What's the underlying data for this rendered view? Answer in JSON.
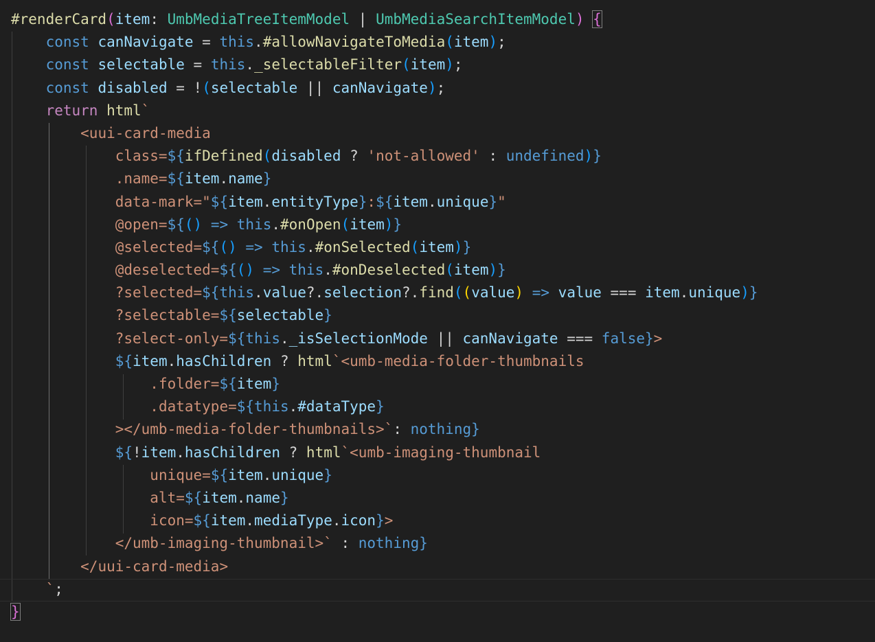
{
  "editor": {
    "language": "typescript",
    "theme_colors": {
      "background": "#1f1f1f",
      "keyword": "#569cd6",
      "function": "#dcdcaa",
      "variable": "#9cdcfe",
      "type": "#4ec9b0",
      "string": "#ce9178",
      "bracket_gold": "#ffd700",
      "bracket_orchid": "#da70d6",
      "bracket_blue": "#179fff"
    },
    "lines": [
      [
        [
          "fn",
          "#renderCard"
        ],
        [
          "b2",
          "("
        ],
        [
          "var",
          "item"
        ],
        [
          "op",
          ": "
        ],
        [
          "type",
          "UmbMediaTreeItemModel"
        ],
        [
          "op",
          " | "
        ],
        [
          "type",
          "UmbMediaSearchItemModel"
        ],
        [
          "b2",
          ")"
        ],
        [
          "op",
          " "
        ],
        [
          "b2hl",
          "{"
        ]
      ],
      [
        [
          "op",
          "    "
        ],
        [
          "kw",
          "const"
        ],
        [
          "op",
          " "
        ],
        [
          "var",
          "canNavigate"
        ],
        [
          "op",
          " = "
        ],
        [
          "kw",
          "this"
        ],
        [
          "op",
          "."
        ],
        [
          "fn",
          "#allowNavigateToMedia"
        ],
        [
          "b3",
          "("
        ],
        [
          "var",
          "item"
        ],
        [
          "b3",
          ")"
        ],
        [
          "op",
          ";"
        ]
      ],
      [
        [
          "op",
          "    "
        ],
        [
          "kw",
          "const"
        ],
        [
          "op",
          " "
        ],
        [
          "var",
          "selectable"
        ],
        [
          "op",
          " = "
        ],
        [
          "kw",
          "this"
        ],
        [
          "op",
          "."
        ],
        [
          "fn",
          "_selectableFilter"
        ],
        [
          "b3",
          "("
        ],
        [
          "var",
          "item"
        ],
        [
          "b3",
          ")"
        ],
        [
          "op",
          ";"
        ]
      ],
      [
        [
          "op",
          "    "
        ],
        [
          "kw",
          "const"
        ],
        [
          "op",
          " "
        ],
        [
          "var",
          "disabled"
        ],
        [
          "op",
          " = !"
        ],
        [
          "b3",
          "("
        ],
        [
          "var",
          "selectable"
        ],
        [
          "op",
          " || "
        ],
        [
          "var",
          "canNavigate"
        ],
        [
          "b3",
          ")"
        ],
        [
          "op",
          ";"
        ]
      ],
      [
        [
          "op",
          "    "
        ],
        [
          "ctl",
          "return"
        ],
        [
          "op",
          " "
        ],
        [
          "fn",
          "html"
        ],
        [
          "str",
          "`"
        ]
      ],
      [
        [
          "op",
          "        "
        ],
        [
          "tag",
          "<uui-card-media"
        ]
      ],
      [
        [
          "op",
          "            "
        ],
        [
          "attr",
          "class="
        ],
        [
          "kw",
          "${"
        ],
        [
          "fn",
          "ifDefined"
        ],
        [
          "b3",
          "("
        ],
        [
          "var",
          "disabled"
        ],
        [
          "op",
          " ? "
        ],
        [
          "str",
          "'not-allowed'"
        ],
        [
          "op",
          " : "
        ],
        [
          "kw",
          "undefined"
        ],
        [
          "b3",
          ")"
        ],
        [
          "kw",
          "}"
        ]
      ],
      [
        [
          "op",
          "            "
        ],
        [
          "attr",
          ".name="
        ],
        [
          "kw",
          "${"
        ],
        [
          "var",
          "item"
        ],
        [
          "op",
          "."
        ],
        [
          "var",
          "name"
        ],
        [
          "kw",
          "}"
        ]
      ],
      [
        [
          "op",
          "            "
        ],
        [
          "attr",
          "data-mark=\""
        ],
        [
          "kw",
          "${"
        ],
        [
          "var",
          "item"
        ],
        [
          "op",
          "."
        ],
        [
          "var",
          "entityType"
        ],
        [
          "kw",
          "}"
        ],
        [
          "str",
          ":"
        ],
        [
          "kw",
          "${"
        ],
        [
          "var",
          "item"
        ],
        [
          "op",
          "."
        ],
        [
          "var",
          "unique"
        ],
        [
          "kw",
          "}"
        ],
        [
          "str",
          "\""
        ]
      ],
      [
        [
          "op",
          "            "
        ],
        [
          "attr",
          "@open="
        ],
        [
          "kw",
          "${"
        ],
        [
          "b3",
          "()"
        ],
        [
          "op",
          " "
        ],
        [
          "kw",
          "=>"
        ],
        [
          "op",
          " "
        ],
        [
          "kw",
          "this"
        ],
        [
          "op",
          "."
        ],
        [
          "fn",
          "#onOpen"
        ],
        [
          "b3",
          "("
        ],
        [
          "var",
          "item"
        ],
        [
          "b3",
          ")"
        ],
        [
          "kw",
          "}"
        ]
      ],
      [
        [
          "op",
          "            "
        ],
        [
          "attr",
          "@selected="
        ],
        [
          "kw",
          "${"
        ],
        [
          "b3",
          "()"
        ],
        [
          "op",
          " "
        ],
        [
          "kw",
          "=>"
        ],
        [
          "op",
          " "
        ],
        [
          "kw",
          "this"
        ],
        [
          "op",
          "."
        ],
        [
          "fn",
          "#onSelected"
        ],
        [
          "b3",
          "("
        ],
        [
          "var",
          "item"
        ],
        [
          "b3",
          ")"
        ],
        [
          "kw",
          "}"
        ]
      ],
      [
        [
          "op",
          "            "
        ],
        [
          "attr",
          "@deselected="
        ],
        [
          "kw",
          "${"
        ],
        [
          "b3",
          "()"
        ],
        [
          "op",
          " "
        ],
        [
          "kw",
          "=>"
        ],
        [
          "op",
          " "
        ],
        [
          "kw",
          "this"
        ],
        [
          "op",
          "."
        ],
        [
          "fn",
          "#onDeselected"
        ],
        [
          "b3",
          "("
        ],
        [
          "var",
          "item"
        ],
        [
          "b3",
          ")"
        ],
        [
          "kw",
          "}"
        ]
      ],
      [
        [
          "op",
          "            "
        ],
        [
          "attr",
          "?selected="
        ],
        [
          "kw",
          "${"
        ],
        [
          "kw",
          "this"
        ],
        [
          "op",
          "."
        ],
        [
          "var",
          "value"
        ],
        [
          "op",
          "?."
        ],
        [
          "var",
          "selection"
        ],
        [
          "op",
          "?."
        ],
        [
          "fn",
          "find"
        ],
        [
          "b3",
          "("
        ],
        [
          "b1",
          "("
        ],
        [
          "var",
          "value"
        ],
        [
          "b1",
          ")"
        ],
        [
          "op",
          " "
        ],
        [
          "kw",
          "=>"
        ],
        [
          "op",
          " "
        ],
        [
          "var",
          "value"
        ],
        [
          "op",
          " === "
        ],
        [
          "var",
          "item"
        ],
        [
          "op",
          "."
        ],
        [
          "var",
          "unique"
        ],
        [
          "b3",
          ")"
        ],
        [
          "kw",
          "}"
        ]
      ],
      [
        [
          "op",
          "            "
        ],
        [
          "attr",
          "?selectable="
        ],
        [
          "kw",
          "${"
        ],
        [
          "var",
          "selectable"
        ],
        [
          "kw",
          "}"
        ]
      ],
      [
        [
          "op",
          "            "
        ],
        [
          "attr",
          "?select-only="
        ],
        [
          "kw",
          "${"
        ],
        [
          "kw",
          "this"
        ],
        [
          "op",
          "."
        ],
        [
          "var",
          "_isSelectionMode"
        ],
        [
          "op",
          " || "
        ],
        [
          "var",
          "canNavigate"
        ],
        [
          "op",
          " === "
        ],
        [
          "kw",
          "false"
        ],
        [
          "kw",
          "}"
        ],
        [
          "tag",
          ">"
        ]
      ],
      [
        [
          "op",
          "            "
        ],
        [
          "kw",
          "${"
        ],
        [
          "var",
          "item"
        ],
        [
          "op",
          "."
        ],
        [
          "var",
          "hasChildren"
        ],
        [
          "op",
          " ? "
        ],
        [
          "fn",
          "html"
        ],
        [
          "str",
          "`"
        ],
        [
          "tag",
          "<umb-media-folder-thumbnails"
        ]
      ],
      [
        [
          "op",
          "                "
        ],
        [
          "attr",
          ".folder="
        ],
        [
          "kw",
          "${"
        ],
        [
          "var",
          "item"
        ],
        [
          "kw",
          "}"
        ]
      ],
      [
        [
          "op",
          "                "
        ],
        [
          "attr",
          ".datatype="
        ],
        [
          "kw",
          "${"
        ],
        [
          "kw",
          "this"
        ],
        [
          "op",
          "."
        ],
        [
          "var",
          "#dataType"
        ],
        [
          "kw",
          "}"
        ]
      ],
      [
        [
          "op",
          "            "
        ],
        [
          "tag",
          "></umb-media-folder-thumbnails>"
        ],
        [
          "str",
          "`"
        ],
        [
          "op",
          ": "
        ],
        [
          "kw",
          "nothing"
        ],
        [
          "kw",
          "}"
        ]
      ],
      [
        [
          "op",
          "            "
        ],
        [
          "kw",
          "${"
        ],
        [
          "op",
          "!"
        ],
        [
          "var",
          "item"
        ],
        [
          "op",
          "."
        ],
        [
          "var",
          "hasChildren"
        ],
        [
          "op",
          " ? "
        ],
        [
          "fn",
          "html"
        ],
        [
          "str",
          "`"
        ],
        [
          "tag",
          "<umb-imaging-thumbnail"
        ]
      ],
      [
        [
          "op",
          "                "
        ],
        [
          "attr",
          "unique="
        ],
        [
          "kw",
          "${"
        ],
        [
          "var",
          "item"
        ],
        [
          "op",
          "."
        ],
        [
          "var",
          "unique"
        ],
        [
          "kw",
          "}"
        ]
      ],
      [
        [
          "op",
          "                "
        ],
        [
          "attr",
          "alt="
        ],
        [
          "kw",
          "${"
        ],
        [
          "var",
          "item"
        ],
        [
          "op",
          "."
        ],
        [
          "var",
          "name"
        ],
        [
          "kw",
          "}"
        ]
      ],
      [
        [
          "op",
          "                "
        ],
        [
          "attr",
          "icon="
        ],
        [
          "kw",
          "${"
        ],
        [
          "var",
          "item"
        ],
        [
          "op",
          "."
        ],
        [
          "var",
          "mediaType"
        ],
        [
          "op",
          "."
        ],
        [
          "var",
          "icon"
        ],
        [
          "kw",
          "}"
        ],
        [
          "tag",
          ">"
        ]
      ],
      [
        [
          "op",
          "            "
        ],
        [
          "tag",
          "</umb-imaging-thumbnail>"
        ],
        [
          "str",
          "`"
        ],
        [
          "op",
          " : "
        ],
        [
          "kw",
          "nothing"
        ],
        [
          "kw",
          "}"
        ]
      ],
      [
        [
          "op",
          "        "
        ],
        [
          "tag",
          "</uui-card-media>"
        ]
      ],
      [
        [
          "op",
          "    "
        ],
        [
          "str",
          "`"
        ],
        [
          "op",
          ";"
        ]
      ],
      [
        [
          "b2hl",
          "}"
        ]
      ]
    ]
  }
}
